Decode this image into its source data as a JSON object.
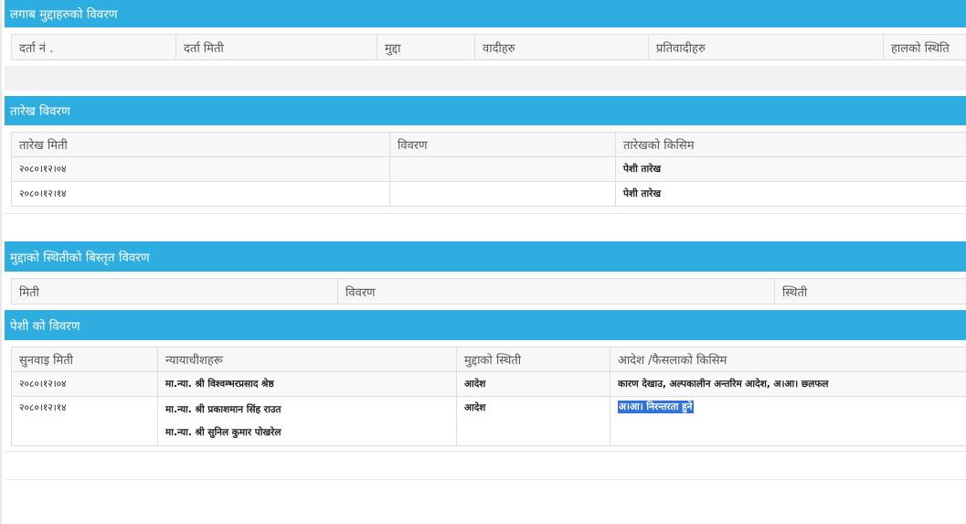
{
  "sections": {
    "related_cases": {
      "title": "लगाब मुद्दाहरुको विवरण",
      "columns": [
        "दर्ता नं .",
        "दर्ता मिती",
        "मुद्दा",
        "वादीहरु",
        "प्रतिवादीहरु",
        "हालको स्थिति"
      ]
    },
    "hearing_dates": {
      "title": "तारेख विवरण",
      "columns": [
        "तारेख मिती",
        "विवरण",
        "तारेखको किसिम"
      ],
      "rows": [
        [
          "२०८०।१२।०४",
          "",
          "पेशी तारेख"
        ],
        [
          "२०८०।१२।१४",
          "",
          "पेशी तारेख"
        ]
      ]
    },
    "case_status": {
      "title": "मुद्दाको स्थितीको बिस्तृत विवरण",
      "columns": [
        "मिती",
        "विवरण",
        "स्थिती"
      ]
    },
    "hearings": {
      "title": "पेशी को विवरण",
      "columns": [
        "सुनवाइ मिती",
        "न्यायाधीशहरू",
        "मुद्दाको स्थिती",
        "आदेश /फैसलाको किसिम"
      ],
      "rows": [
        {
          "date": "२०८०।१२।०४",
          "judges": [
            "मा.न्या. श्री विश्वम्भरप्रसाद श्रेष्ठ"
          ],
          "status": "आदेश",
          "order_type": "कारण देखाउ, अल्पकालीन अन्तरिम आदेश, अ।आ। छलफल"
        },
        {
          "date": "२०८०।१२।१४",
          "judges": [
            "मा.न्या. श्री प्रकाशमान सिंह राउत",
            "मा.न्या. श्री सुनिल कुमार पोखरेल"
          ],
          "status": "आदेश",
          "order_type": "अ।आ। निरन्तरता हुने"
        }
      ]
    }
  },
  "colors": {
    "header_blue": "#2eaee0",
    "selection_blue": "#3372d6"
  }
}
